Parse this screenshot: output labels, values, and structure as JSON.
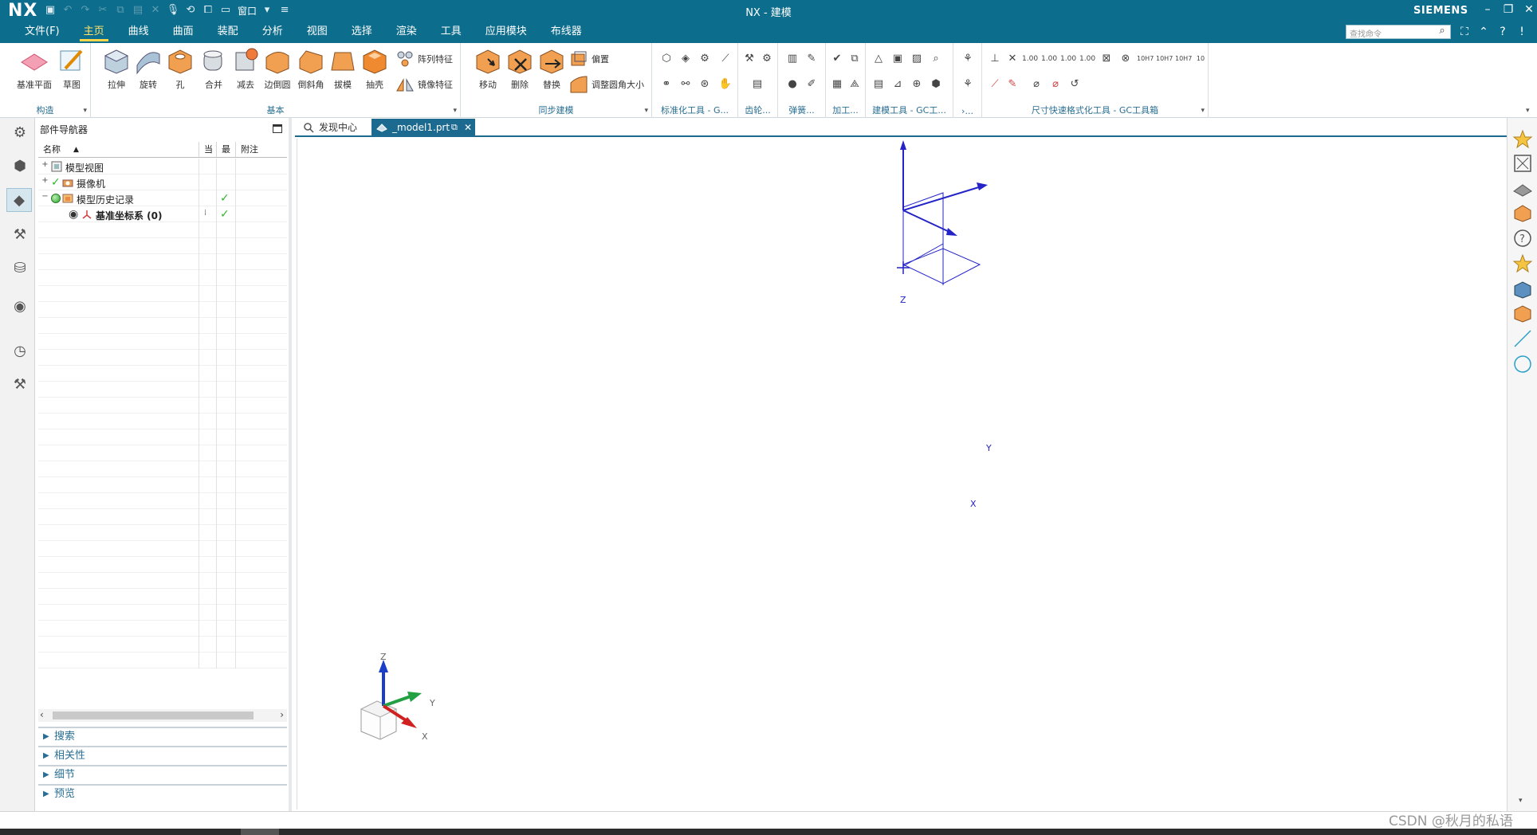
{
  "window": {
    "logo": "NX",
    "title": "NX - 建模",
    "brand": "SIEMENS",
    "window_menu": "窗口"
  },
  "menus": [
    {
      "label": "文件(F)"
    },
    {
      "label": "主页",
      "active": true
    },
    {
      "label": "曲线"
    },
    {
      "label": "曲面"
    },
    {
      "label": "装配"
    },
    {
      "label": "分析"
    },
    {
      "label": "视图"
    },
    {
      "label": "选择"
    },
    {
      "label": "渲染"
    },
    {
      "label": "工具"
    },
    {
      "label": "应用模块"
    },
    {
      "label": "布线器"
    }
  ],
  "command_search": {
    "placeholder": "查找命令"
  },
  "ribbon": {
    "construct": {
      "label": "构造",
      "datum_plane": "基准平面",
      "sketch": "草图"
    },
    "base": {
      "label": "基本",
      "extrude": "拉伸",
      "revolve": "旋转",
      "hole": "孔",
      "unite": "合并",
      "subtract": "减去",
      "edge_blend": "边倒圆",
      "chamfer": "倒斜角",
      "draft": "拔模",
      "shell": "抽壳",
      "pattern_feature": "阵列特征",
      "mirror_feature": "镜像特征"
    },
    "sync": {
      "label": "同步建模",
      "move": "移动",
      "delete": "删除",
      "replace": "替换",
      "offset": "偏置",
      "resize_blend": "调整圆角大小"
    },
    "std_tools": {
      "label": "标准化工具 - G..."
    },
    "gear": {
      "label": "齿轮..."
    },
    "spring": {
      "label": "弹簧..."
    },
    "machining": {
      "label": "加工..."
    },
    "gc_tools": {
      "label": "建模工具 - GC工..."
    },
    "more": {
      "label": "›..."
    },
    "dim_tools": {
      "label": "尺寸快速格式化工具 - GC工具箱"
    }
  },
  "navigator": {
    "title": "部件导航器",
    "columns": {
      "name": "名称",
      "current": "当",
      "latest": "最",
      "note": "附注"
    },
    "rows": [
      {
        "toggle": "+",
        "label": "模型视图"
      },
      {
        "toggle": "+",
        "label": "摄像机"
      },
      {
        "toggle": "−",
        "label": "模型历史记录"
      },
      {
        "label": "基准坐标系 (0)"
      }
    ],
    "sections": [
      {
        "label": "搜索"
      },
      {
        "label": "相关性"
      },
      {
        "label": "细节"
      },
      {
        "label": "预览"
      }
    ]
  },
  "tabs": [
    {
      "label": "发现中心"
    },
    {
      "label": "_model1.prt"
    }
  ],
  "axes": {
    "x": "X",
    "y": "Y",
    "z": "Z"
  },
  "watermark": "CSDN @秋月的私语",
  "colors": {
    "titlebar": "#0d6d8c",
    "active_tab": "#1c6a8f",
    "accent": "#ffd54a",
    "datum_csys": "#2323c8"
  }
}
